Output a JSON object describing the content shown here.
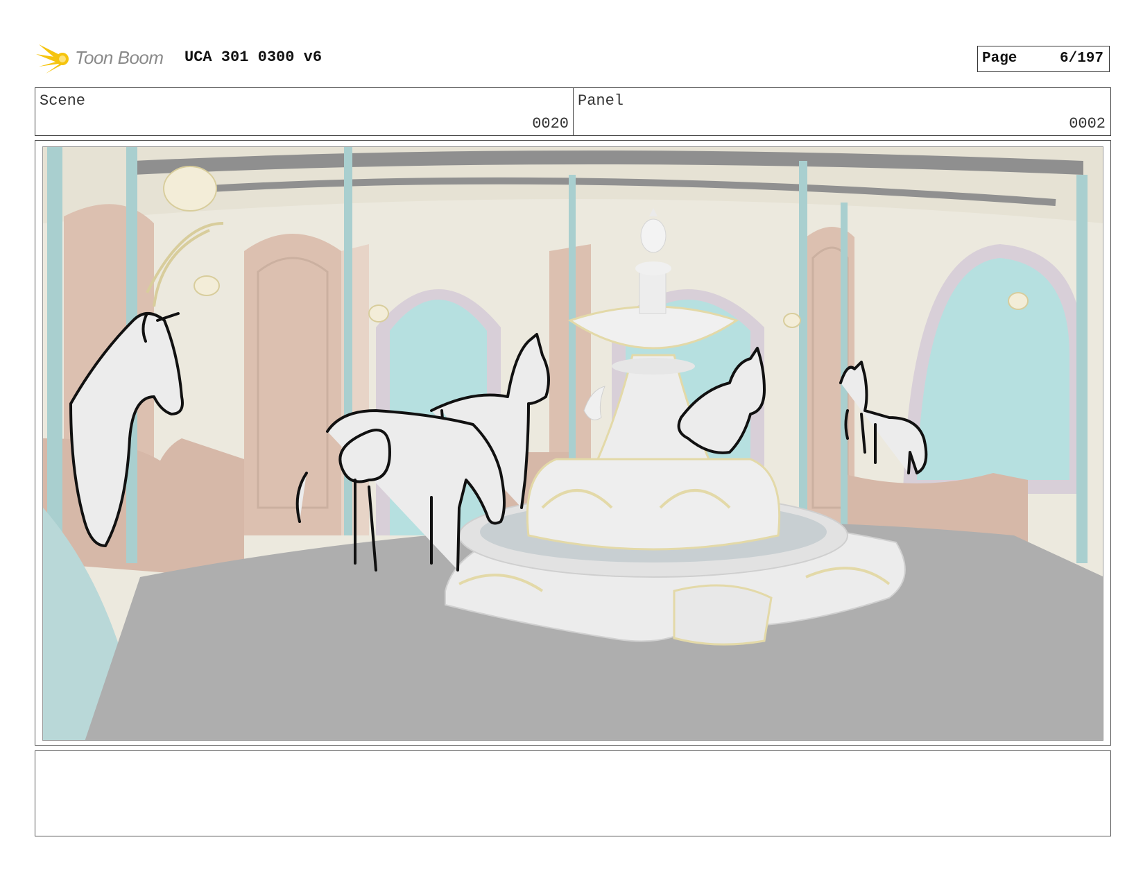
{
  "header": {
    "logo_text": "Toon Boom",
    "doc_title": "UCA 301 0300 v6",
    "page_label": "Page",
    "page_number": "6/197"
  },
  "info": {
    "scene_label": "Scene",
    "scene_value": "0020",
    "panel_label": "Panel",
    "panel_value": "0002"
  },
  "notes": {
    "text": ""
  },
  "colors": {
    "wall": "#ece9de",
    "pillar": "#a9cfcf",
    "window_glass": "#b6e0e0",
    "door_wood": "#dcc0b0",
    "floor": "#aeaeae",
    "fountain": "#ececec",
    "fountain_trim": "#e8ddb0",
    "sketch_line": "#111111",
    "logo_yellow": "#f5c40e"
  }
}
